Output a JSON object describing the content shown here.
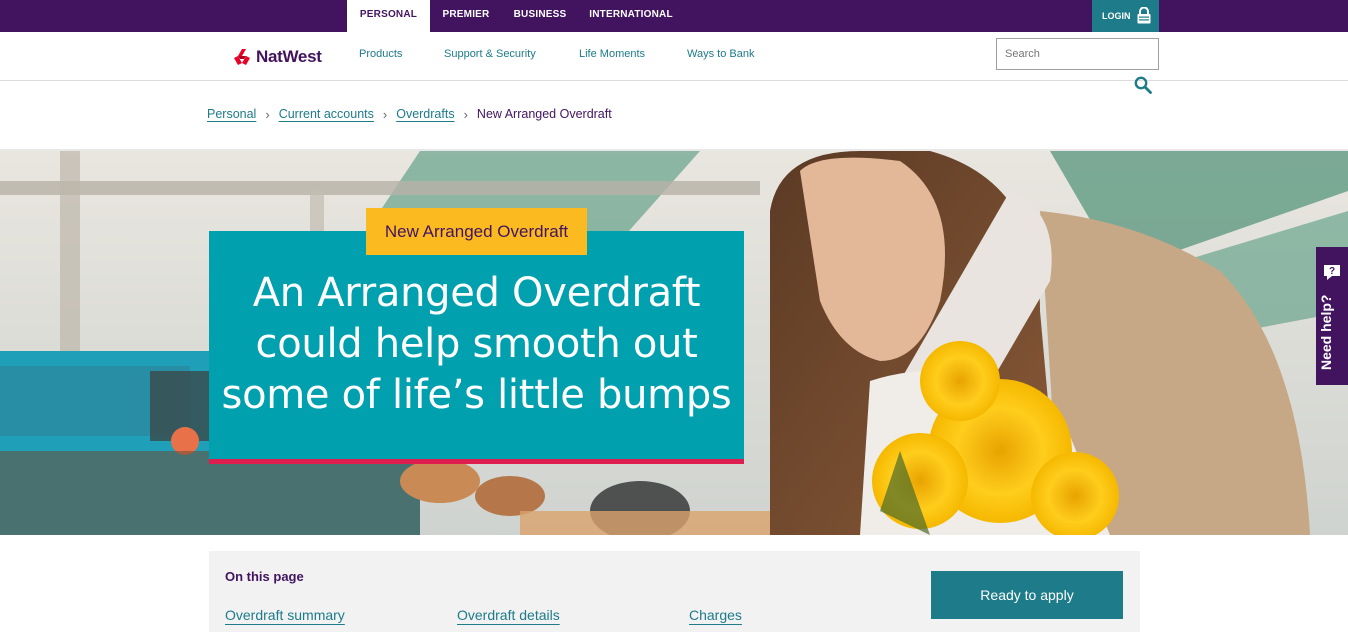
{
  "colors": {
    "brand_purple": "#42145f",
    "teal": "#1d7b8a",
    "hero_card": "#00a0af",
    "tag_yellow": "#fbba20",
    "accent_red": "#de1e4e"
  },
  "topbar": {
    "tabs": [
      {
        "label": "PERSONAL",
        "active": true
      },
      {
        "label": "PREMIER",
        "active": false
      },
      {
        "label": "BUSINESS",
        "active": false
      },
      {
        "label": "INTERNATIONAL",
        "active": false
      }
    ],
    "login_label": "LOGIN",
    "login_icon": "lock-icon"
  },
  "nav": {
    "brand": "NatWest",
    "logo_icon": "natwest-chevrons-logo",
    "links": [
      "Products",
      "Support & Security",
      "Life Moments",
      "Ways to Bank"
    ],
    "search_placeholder": "Search",
    "search_icon": "search-icon"
  },
  "breadcrumb": {
    "items": [
      "Personal",
      "Current accounts",
      "Overdrafts"
    ],
    "current": "New Arranged Overdraft"
  },
  "hero": {
    "tag": "New Arranged Overdraft",
    "title_lines": [
      "An Arranged Overdraft",
      "could help smooth out",
      "some of life’s little bumps"
    ]
  },
  "need_help": {
    "label": "Need help?",
    "icon": "chat-bubble-icon"
  },
  "on_this_page": {
    "title": "On this page",
    "links": [
      "Overdraft summary",
      "Overdraft details",
      "Charges"
    ],
    "cta": "Ready to apply"
  }
}
